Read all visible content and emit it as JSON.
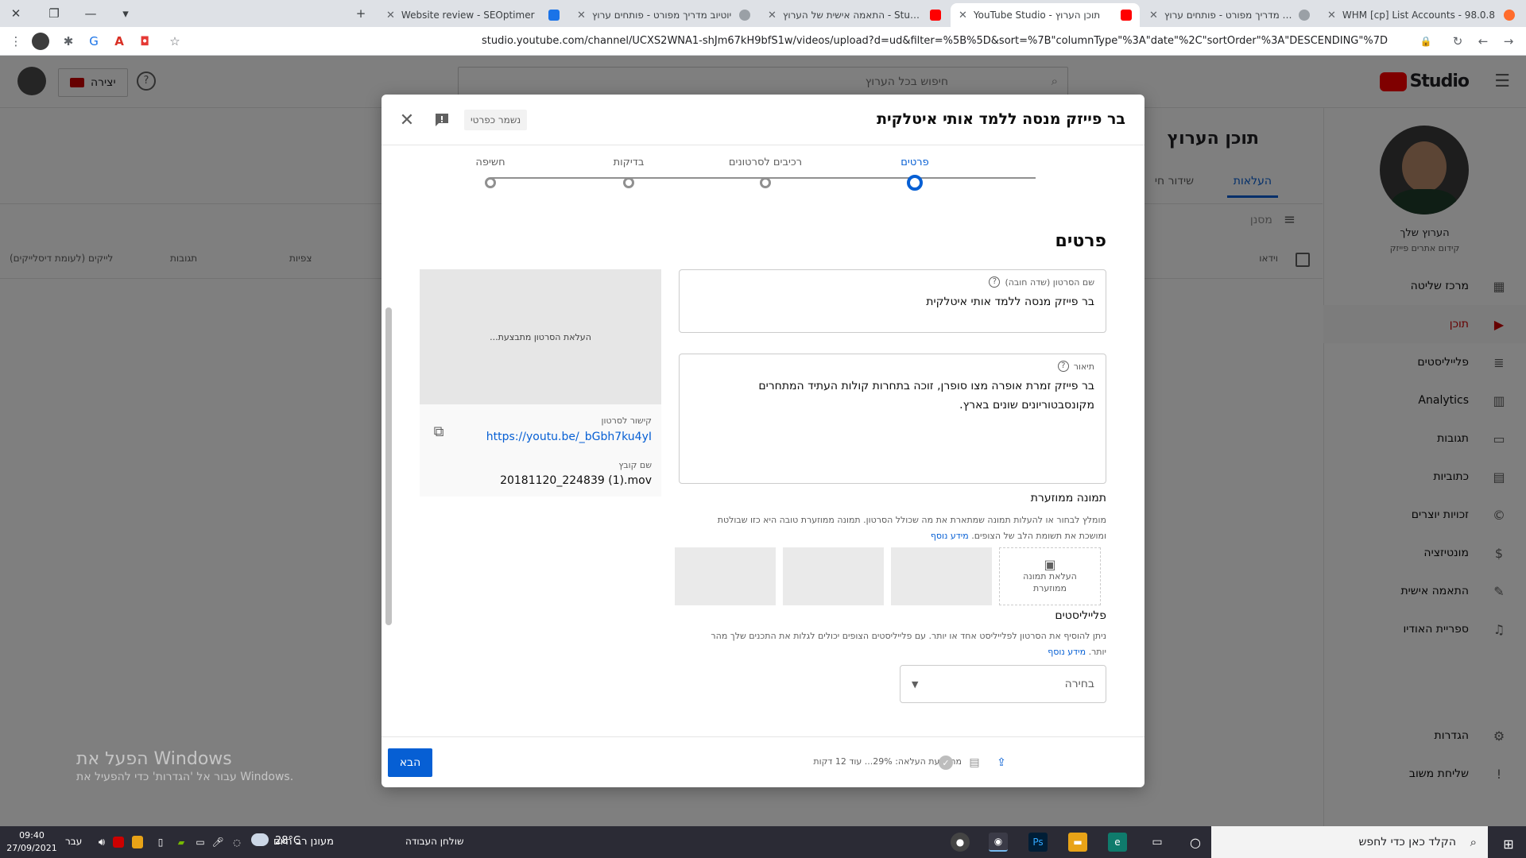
{
  "browser": {
    "tabs": [
      {
        "title": "WHM [cp] List Accounts - 98.0.8",
        "favicon": "cpanel-icon",
        "active": false
      },
      {
        "title": "יוטיוב מדריך מפורט - פותחים ערוץ",
        "favicon": "extension-icon",
        "active": false
      },
      {
        "title": "YouTube Studio - תוכן הערוץ",
        "favicon": "youtube-icon",
        "active": true
      },
      {
        "title": "התאמה אישית של הערוץ - Studio",
        "favicon": "youtube-icon",
        "active": false
      },
      {
        "title": "יוטיוב מדריך מפורט - פותחים ערוץ",
        "favicon": "extension-icon",
        "active": false
      },
      {
        "title": "Website review - SEOptimer",
        "favicon": "seoptimer-icon",
        "active": false
      }
    ],
    "url": "studio.youtube.com/channel/UCXS2WNA1-shJm67kH9bfS1w/videos/upload?d=ud&filter=%5B%5D&sort=%7B\"columnType\"%3A\"date\"%2C\"sortOrder\"%3A\"DESCENDING\"%7D"
  },
  "studio": {
    "logo_text": "Studio",
    "search_placeholder": "חיפוש בכל הערוץ",
    "create_label": "יצירה",
    "page_title": "תוכן הערוץ",
    "tabs": [
      "העלאות",
      "שידור חי"
    ],
    "filter_label": "מסנן",
    "columns": [
      "וידאו",
      "צפיות",
      "תגובות",
      "לייקים (לעומת דיסלייקים)"
    ],
    "channel": {
      "name": "הערוץ שלך",
      "handle": "קידום אתרים פייזק"
    },
    "nav": [
      {
        "label": "מרכז שליטה",
        "icon": "dashboard-icon",
        "active": false
      },
      {
        "label": "תוכן",
        "icon": "content-icon",
        "active": true
      },
      {
        "label": "פלייליסטים",
        "icon": "playlists-icon",
        "active": false
      },
      {
        "label": "Analytics",
        "icon": "analytics-icon",
        "active": false
      },
      {
        "label": "תגובות",
        "icon": "comments-icon",
        "active": false
      },
      {
        "label": "כתוביות",
        "icon": "subtitles-icon",
        "active": false
      },
      {
        "label": "זכויות יוצרים",
        "icon": "copyright-icon",
        "active": false
      },
      {
        "label": "מונטיזציה",
        "icon": "monetization-icon",
        "active": false
      },
      {
        "label": "התאמה אישית",
        "icon": "customization-icon",
        "active": false
      },
      {
        "label": "ספריית האודיו",
        "icon": "audio-library-icon",
        "active": false
      }
    ],
    "nav_bottom": [
      {
        "label": "הגדרות",
        "icon": "settings-icon"
      },
      {
        "label": "שליחת משוב",
        "icon": "feedback-icon"
      }
    ]
  },
  "modal": {
    "title": "בר פייזק מנסה ללמד אותי איטלקית",
    "draft_badge": "נשמר כפרטי",
    "steps": [
      "פרטים",
      "רכיבים לסרטונים",
      "בדיקות",
      "חשיפה"
    ],
    "active_step": 0,
    "section_title": "פרטים",
    "title_field": {
      "label": "שם הסרטון (שדה חובה)",
      "value": "בר פייזק מנסה ללמד אותי איטלקית"
    },
    "desc_field": {
      "label": "תיאור",
      "value": "בר פייזק זמרת אופרה מצו סופרן, זוכה בתחרות קולות העתיד המתחרים מקונסבטוריונים שונים בארץ."
    },
    "preview": {
      "processing": "העלאת הסרטון מתבצעת...",
      "link_label": "קישור לסרטון",
      "link": "https://youtu.be/_bGbh7ku4yI",
      "file_label": "שם קובץ",
      "file_name": "20181120_224839 (1).mov"
    },
    "thumbnail": {
      "label": "תמונה ממוזערת",
      "desc": "מומלץ לבחור או להעלות תמונה שמתארת את מה שכולל הסרטון. תמונה ממוזערת טובה היא כזו שבולטת ומושכת את תשומת הלב של הצופים.",
      "more": "מידע נוסף",
      "upload": "העלאת תמונה ממוזערת"
    },
    "playlists": {
      "label": "פלייליסטים",
      "desc": "ניתן להוסיף את הסרטון לפלייליסט אחד או יותר. עם פלייליסטים הצופים יכולים לגלות את התכנים שלך מהר יותר.",
      "more": "מידע נוסף",
      "select": "בחירה"
    },
    "footer": {
      "status": "מתבצעת העלאה: 29%... עוד 12 דקות",
      "next": "הבא",
      "progress": 0.29
    }
  },
  "watermark": {
    "line1": "הפעל את Windows",
    "line2": "עבור אל 'הגדרות' כדי להפעיל את Windows."
  },
  "taskbar": {
    "search": "הקלד כאן כדי לחפש",
    "desktop": "שולחן העבודה",
    "weather_temp": "28°C",
    "weather_text": "מעונן רב היום",
    "lang": "עבר",
    "time": "09:40",
    "date": "27/09/2021"
  },
  "colors": {
    "accent": "#065fd4",
    "youtube_red": "#ff0000"
  }
}
